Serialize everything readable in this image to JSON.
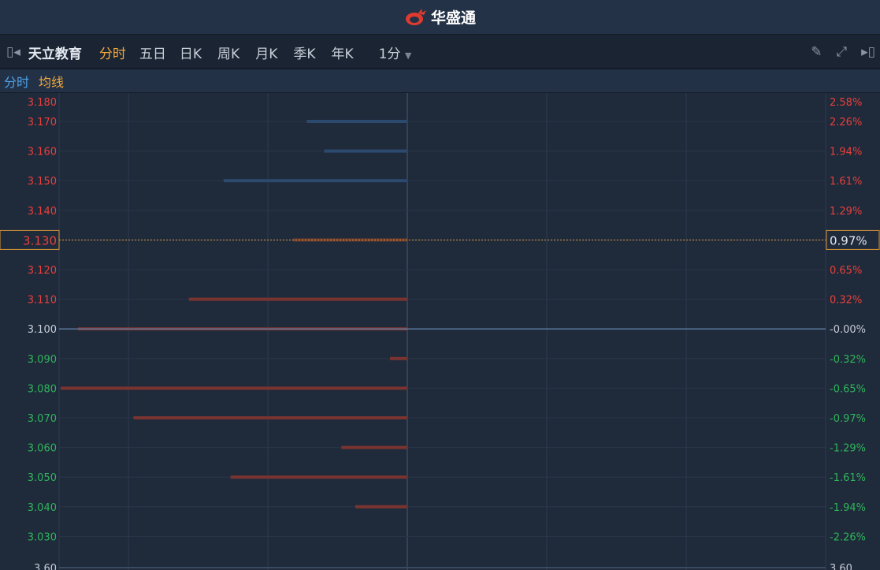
{
  "header": {
    "brand": "华盛通"
  },
  "toolbar": {
    "stock_name": "天立教育",
    "periods": [
      "分时",
      "五日",
      "日K",
      "周K",
      "月K",
      "季K",
      "年K"
    ],
    "active_period": "分时",
    "interval": "1分"
  },
  "legend": {
    "line": "分时",
    "avg": "均线",
    "line_color": "#4da3e8",
    "avg_color": "#f0a93c"
  },
  "current": {
    "price": "3.130",
    "pct": "0.97%"
  },
  "chart_data": {
    "type": "line",
    "title": "天立教育 分时",
    "ylim": [
      3.02,
      3.185
    ],
    "prev_close": 3.1,
    "price_ticks": [
      "3.180",
      "3.170",
      "3.160",
      "3.150",
      "3.140",
      "3.130",
      "3.120",
      "3.110",
      "3.100",
      "3.090",
      "3.080",
      "3.070",
      "3.060",
      "3.050",
      "3.040",
      "3.030"
    ],
    "pct_ticks": [
      "2.58%",
      "2.26%",
      "1.94%",
      "1.61%",
      "1.29%",
      "0.97%",
      "0.65%",
      "0.32%",
      "-0.00%",
      "-0.32%",
      "-0.65%",
      "-0.97%",
      "-1.29%",
      "-1.61%",
      "-1.94%",
      "-2.26%"
    ],
    "bottom_labels": [
      "3.60",
      "3.60"
    ],
    "price_line": [
      3.1,
      3.1
    ],
    "volume_profile": [
      {
        "price": 3.17,
        "rel_volume": 0.29,
        "side": "buy"
      },
      {
        "price": 3.16,
        "rel_volume": 0.24,
        "side": "buy"
      },
      {
        "price": 3.15,
        "rel_volume": 0.53,
        "side": "buy"
      },
      {
        "price": 3.13,
        "rel_volume": 0.33,
        "side": "current"
      },
      {
        "price": 3.11,
        "rel_volume": 0.63,
        "side": "sell"
      },
      {
        "price": 3.1,
        "rel_volume": 0.95,
        "side": "sell"
      },
      {
        "price": 3.09,
        "rel_volume": 0.05,
        "side": "sell"
      },
      {
        "price": 3.08,
        "rel_volume": 1.0,
        "side": "sell"
      },
      {
        "price": 3.07,
        "rel_volume": 0.79,
        "side": "sell"
      },
      {
        "price": 3.06,
        "rel_volume": 0.19,
        "side": "sell"
      },
      {
        "price": 3.05,
        "rel_volume": 0.51,
        "side": "sell"
      },
      {
        "price": 3.04,
        "rel_volume": 0.15,
        "side": "sell"
      }
    ]
  }
}
